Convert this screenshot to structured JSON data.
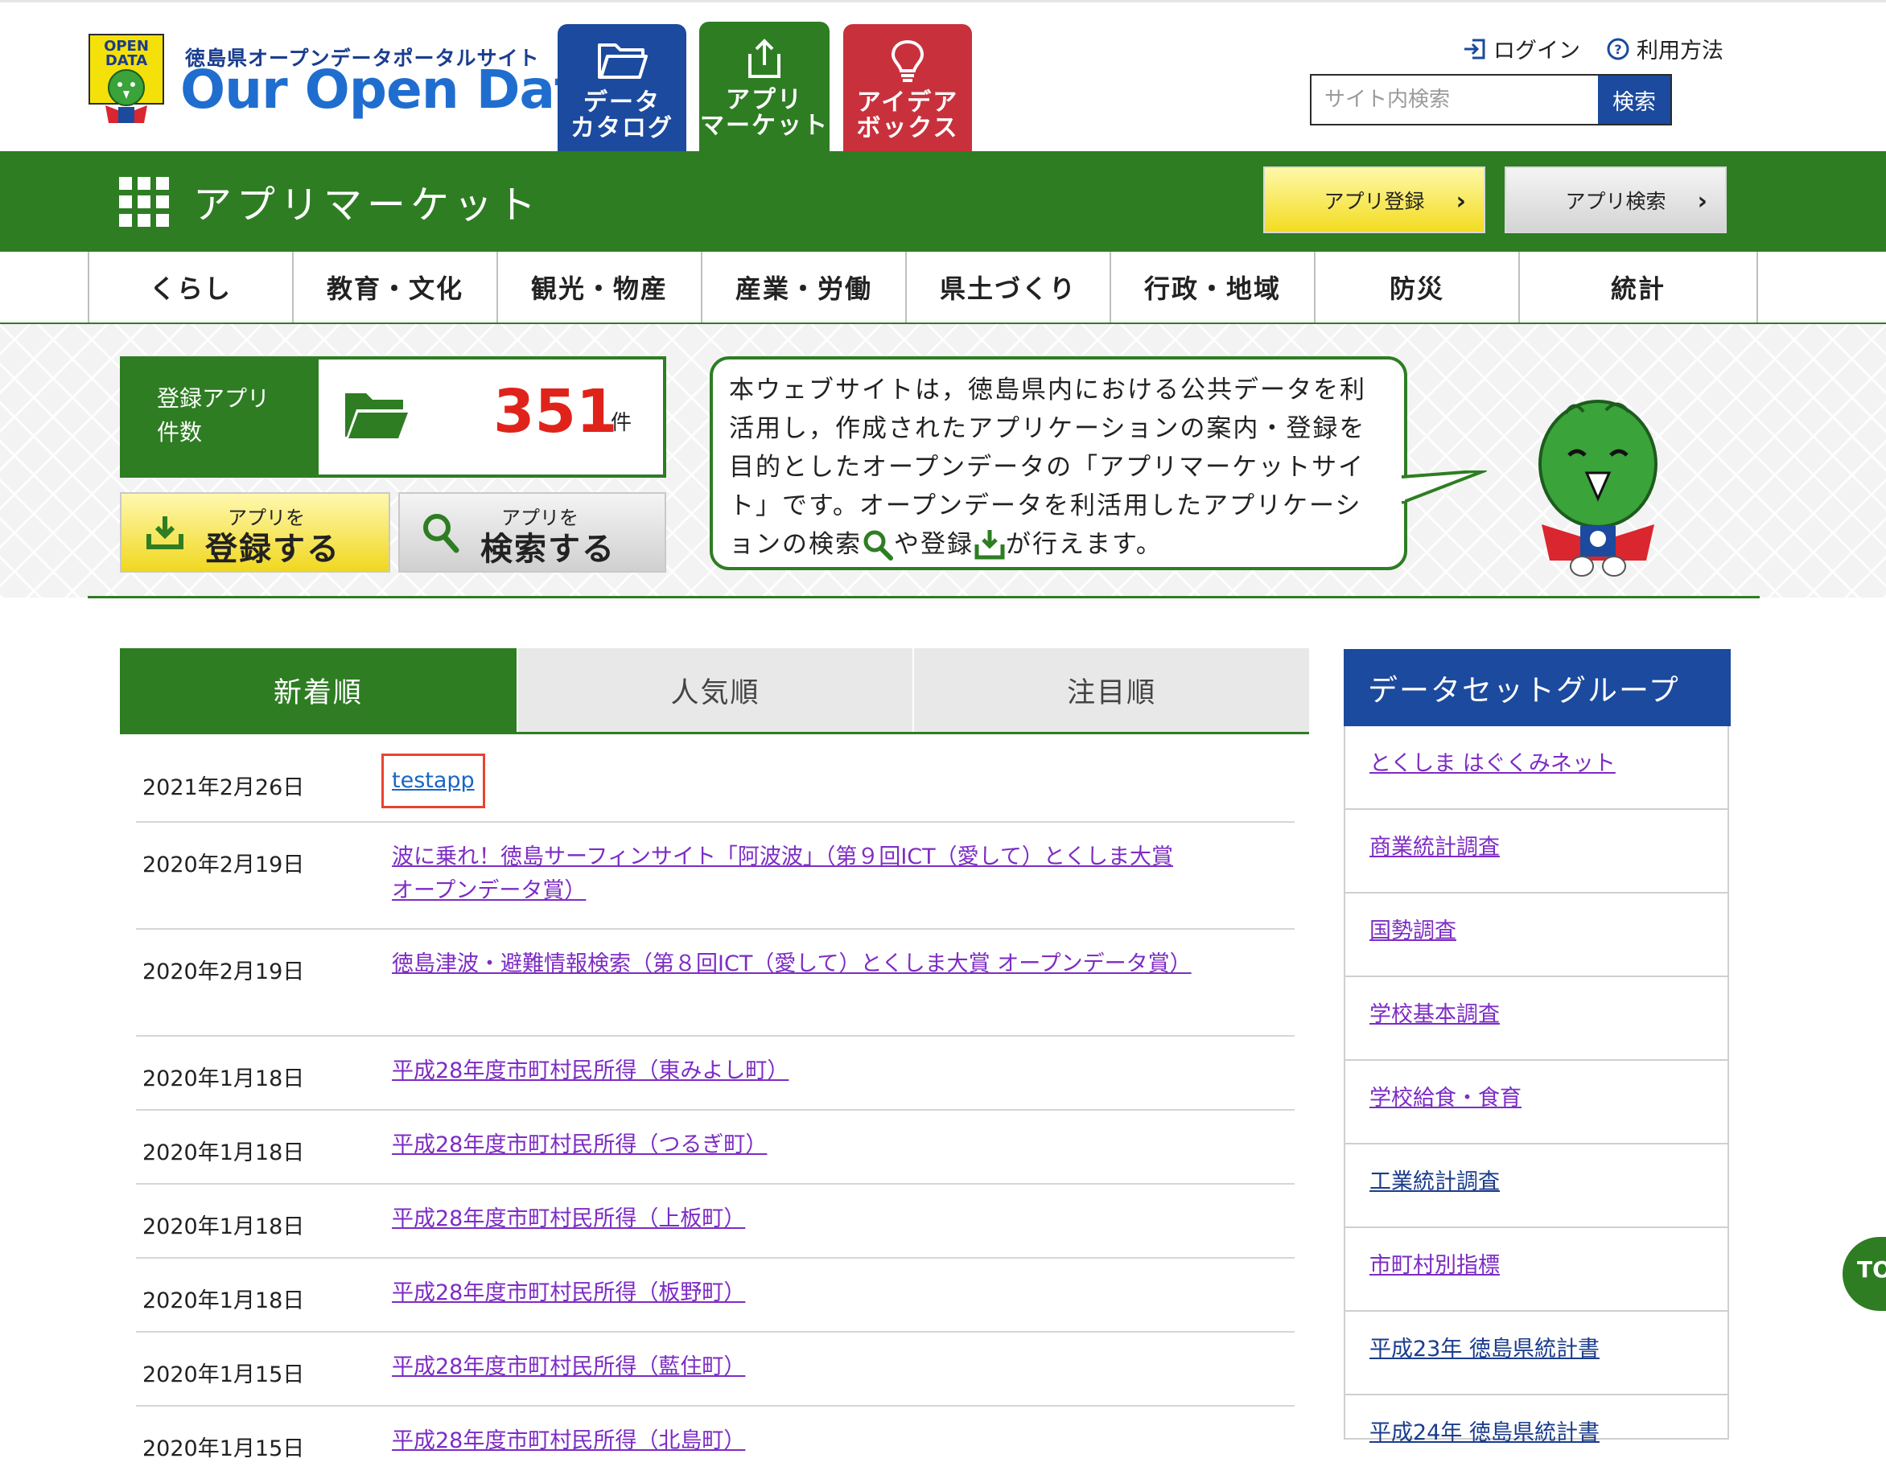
{
  "header": {
    "logo_badge": "OPEN DATA",
    "logo_sub": "徳島県オープンデータポータルサイト",
    "logo_main": "Our Open Data",
    "tabs": [
      {
        "label": "データ\nカタログ",
        "icon": "folder-icon"
      },
      {
        "label": "アプリ\nマーケット",
        "icon": "upload-icon"
      },
      {
        "label": "アイデア\nボックス",
        "icon": "lightbulb-icon"
      }
    ],
    "login": "ログイン",
    "help": "利用方法",
    "search_placeholder": "サイト内検索",
    "search_button": "検索"
  },
  "greenbar": {
    "title": "アプリマーケット",
    "register_button": "アプリ登録",
    "search_button": "アプリ検索"
  },
  "categories": [
    "くらし",
    "教育・文化",
    "観光・物産",
    "産業・労働",
    "県土づくり",
    "行政・地域",
    "防災",
    "統計"
  ],
  "hero": {
    "count_label": "登録アプリ\n件数",
    "count": "351",
    "count_unit": "件",
    "register_small": "アプリを",
    "register_big": "登録する",
    "search_small": "アプリを",
    "search_big": "検索する",
    "bubble_part1": "本ウェブサイトは，徳島県内における公共データを利活用し，作成されたアプリケーションの案内・登録を目的としたオープンデータの「アプリマーケットサイト」です。オープンデータを利活用したアプリケーションの検索",
    "bubble_part2": "や登録",
    "bubble_part3": "が行えます。"
  },
  "sort_tabs": [
    "新着順",
    "人気順",
    "注目順"
  ],
  "apps": [
    {
      "date": "2021年2月26日",
      "title": "testapp"
    },
    {
      "date": "2020年2月19日",
      "title": "波に乗れ！徳島サーフィンサイト「阿波波」（第９回ICT（愛して）とくしま大賞 オープンデータ賞）"
    },
    {
      "date": "2020年2月19日",
      "title": "徳島津波・避難情報検索（第８回ICT（愛して）とくしま大賞 オープンデータ賞）"
    },
    {
      "date": "2020年1月18日",
      "title": "平成28年度市町村民所得（東みよし町）"
    },
    {
      "date": "2020年1月18日",
      "title": "平成28年度市町村民所得（つるぎ町）"
    },
    {
      "date": "2020年1月18日",
      "title": "平成28年度市町村民所得（上板町）"
    },
    {
      "date": "2020年1月18日",
      "title": "平成28年度市町村民所得（板野町）"
    },
    {
      "date": "2020年1月15日",
      "title": "平成28年度市町村民所得（藍住町）"
    },
    {
      "date": "2020年1月15日",
      "title": "平成28年度市町村民所得（北島町）"
    }
  ],
  "sidebar": {
    "title": "データセットグループ",
    "items": [
      "とくしま はぐくみネット",
      "商業統計調査",
      "国勢調査",
      "学校基本調査",
      "学校給食・食育",
      "工業統計調査",
      "市町村別指標",
      "平成23年 徳島県統計書",
      "平成24年 徳島県統計書"
    ]
  },
  "top_button": "TO"
}
